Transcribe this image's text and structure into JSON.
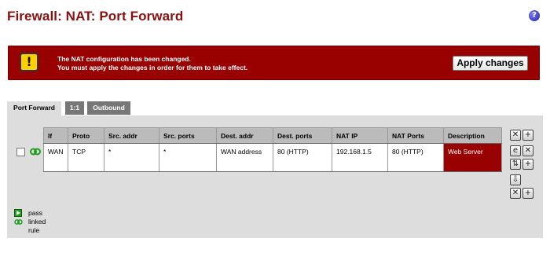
{
  "page": {
    "title": "Firewall: NAT: Port Forward",
    "help_icon": "question-icon"
  },
  "alert": {
    "icon": "warning-icon",
    "line1": "The NAT configuration has been changed.",
    "line2": "You must apply the changes in order for them to take effect.",
    "apply_label": "Apply changes",
    "bg_color": "#990000"
  },
  "tabs": [
    {
      "label": "Port Forward",
      "active": true
    },
    {
      "label": "1:1",
      "active": false
    },
    {
      "label": "Outbound",
      "active": false
    }
  ],
  "table": {
    "headers": [
      "If",
      "Proto",
      "Src. addr",
      "Src. ports",
      "Dest. addr",
      "Dest. ports",
      "NAT IP",
      "NAT Ports",
      "Description"
    ],
    "rows": [
      {
        "if": "WAN",
        "proto": "TCP",
        "src_addr": "*",
        "src_ports": "*",
        "dest_addr": "WAN address",
        "dest_ports": "80 (HTTP)",
        "nat_ip": "192.168.1.5",
        "nat_ports": "80 (HTTP)",
        "description": "Web Server",
        "checked": false,
        "linked": true
      }
    ]
  },
  "legend": {
    "pass": "pass",
    "linked_rule": "linked rule"
  }
}
